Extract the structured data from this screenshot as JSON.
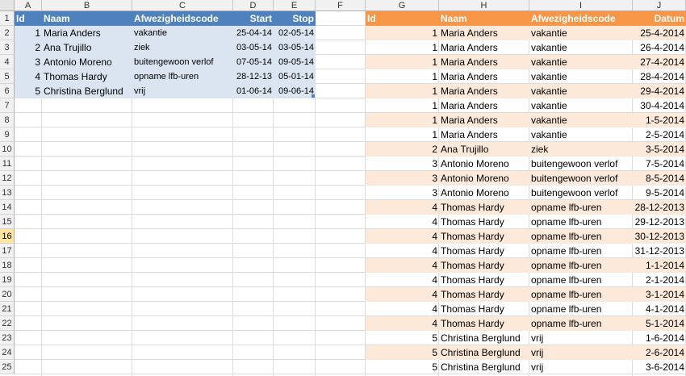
{
  "columns": [
    "A",
    "B",
    "C",
    "D",
    "E",
    "F",
    "G",
    "H",
    "I",
    "J"
  ],
  "rows": [
    "1",
    "2",
    "3",
    "4",
    "5",
    "6",
    "7",
    "8",
    "9",
    "10",
    "11",
    "12",
    "13",
    "14",
    "15",
    "16",
    "17",
    "18",
    "19",
    "20",
    "21",
    "22",
    "23",
    "24",
    "25"
  ],
  "selected_row": "16",
  "left_table": {
    "headers": [
      "Id",
      "Naam",
      "Afwezigheidscode",
      "Start",
      "Stop"
    ],
    "rows": [
      [
        "1",
        "Maria Anders",
        "vakantie",
        "25-04-14",
        "02-05-14"
      ],
      [
        "2",
        "Ana Trujillo",
        "ziek",
        "03-05-14",
        "03-05-14"
      ],
      [
        "3",
        "Antonio Moreno",
        "buitengewoon verlof",
        "07-05-14",
        "09-05-14"
      ],
      [
        "4",
        "Thomas Hardy",
        "opname lfb-uren",
        "28-12-13",
        "05-01-14"
      ],
      [
        "5",
        "Christina Berglund",
        "vrij",
        "01-06-14",
        "09-06-14"
      ]
    ],
    "header_color": "#4f81bd",
    "band_color": "#dbe5f1"
  },
  "right_table": {
    "headers": [
      "Id",
      "Naam",
      "Afwezigheidscode",
      "Datum"
    ],
    "rows": [
      [
        "1",
        "Maria Anders",
        "vakantie",
        "25-4-2014"
      ],
      [
        "1",
        "Maria Anders",
        "vakantie",
        "26-4-2014"
      ],
      [
        "1",
        "Maria Anders",
        "vakantie",
        "27-4-2014"
      ],
      [
        "1",
        "Maria Anders",
        "vakantie",
        "28-4-2014"
      ],
      [
        "1",
        "Maria Anders",
        "vakantie",
        "29-4-2014"
      ],
      [
        "1",
        "Maria Anders",
        "vakantie",
        "30-4-2014"
      ],
      [
        "1",
        "Maria Anders",
        "vakantie",
        "1-5-2014"
      ],
      [
        "1",
        "Maria Anders",
        "vakantie",
        "2-5-2014"
      ],
      [
        "2",
        "Ana Trujillo",
        "ziek",
        "3-5-2014"
      ],
      [
        "3",
        "Antonio Moreno",
        "buitengewoon verlof",
        "7-5-2014"
      ],
      [
        "3",
        "Antonio Moreno",
        "buitengewoon verlof",
        "8-5-2014"
      ],
      [
        "3",
        "Antonio Moreno",
        "buitengewoon verlof",
        "9-5-2014"
      ],
      [
        "4",
        "Thomas Hardy",
        "opname lfb-uren",
        "28-12-2013"
      ],
      [
        "4",
        "Thomas Hardy",
        "opname lfb-uren",
        "29-12-2013"
      ],
      [
        "4",
        "Thomas Hardy",
        "opname lfb-uren",
        "30-12-2013"
      ],
      [
        "4",
        "Thomas Hardy",
        "opname lfb-uren",
        "31-12-2013"
      ],
      [
        "4",
        "Thomas Hardy",
        "opname lfb-uren",
        "1-1-2014"
      ],
      [
        "4",
        "Thomas Hardy",
        "opname lfb-uren",
        "2-1-2014"
      ],
      [
        "4",
        "Thomas Hardy",
        "opname lfb-uren",
        "3-1-2014"
      ],
      [
        "4",
        "Thomas Hardy",
        "opname lfb-uren",
        "4-1-2014"
      ],
      [
        "4",
        "Thomas Hardy",
        "opname lfb-uren",
        "5-1-2014"
      ],
      [
        "5",
        "Christina Berglund",
        "vrij",
        "1-6-2014"
      ],
      [
        "5",
        "Christina Berglund",
        "vrij",
        "2-6-2014"
      ],
      [
        "5",
        "Christina Berglund",
        "vrij",
        "3-6-2014"
      ]
    ],
    "header_color": "#f79646",
    "band_color": "#fde9d9"
  }
}
